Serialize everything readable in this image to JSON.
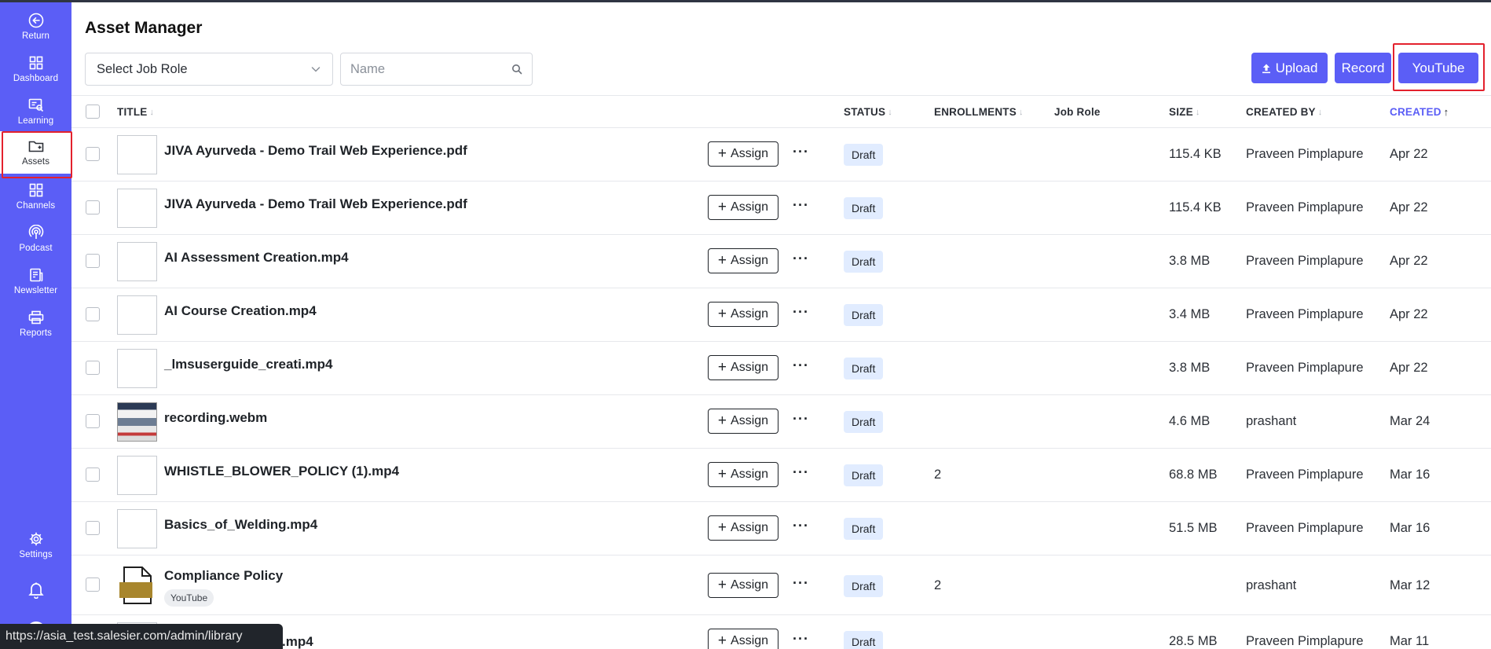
{
  "sidebar": {
    "items": [
      {
        "label": "Return",
        "icon": "return-icon"
      },
      {
        "label": "Dashboard",
        "icon": "dashboard-icon"
      },
      {
        "label": "Learning",
        "icon": "learning-icon"
      },
      {
        "label": "Assets",
        "icon": "assets-folder-icon",
        "active": true
      },
      {
        "label": "Channels",
        "icon": "channels-icon"
      },
      {
        "label": "Podcast",
        "icon": "podcast-icon"
      },
      {
        "label": "Newsletter",
        "icon": "newsletter-icon"
      },
      {
        "label": "Reports",
        "icon": "reports-printer-icon"
      }
    ],
    "bottom": [
      {
        "label": "Settings",
        "icon": "gear-icon"
      },
      {
        "label": "",
        "icon": "bell-icon"
      },
      {
        "label": "",
        "icon": "user-avatar-icon"
      }
    ]
  },
  "header": {
    "title": "Asset Manager",
    "job_role_select": "Select Job Role",
    "search_placeholder": "Name",
    "buttons": {
      "upload": "Upload",
      "record": "Record",
      "youtube": "YouTube"
    }
  },
  "table": {
    "columns": {
      "title": "TITLE",
      "status": "STATUS",
      "enrollments": "ENROLLMENTS",
      "job_role": "Job Role",
      "size": "SIZE",
      "created_by": "CREATED BY",
      "created": "CREATED"
    },
    "assign_label": "Assign",
    "more_label": "···",
    "rows": [
      {
        "title": "JIVA Ayurveda - Demo Trail Web Experience.pdf",
        "status": "Draft",
        "enrollments": "",
        "job_role": "",
        "size": "115.4 KB",
        "created_by": "Praveen Pimplapure",
        "created": "Apr 22",
        "thumb": "blank"
      },
      {
        "title": "JIVA Ayurveda - Demo Trail Web Experience.pdf",
        "status": "Draft",
        "enrollments": "",
        "job_role": "",
        "size": "115.4 KB",
        "created_by": "Praveen Pimplapure",
        "created": "Apr 22",
        "thumb": "blank"
      },
      {
        "title": "AI Assessment Creation.mp4",
        "status": "Draft",
        "enrollments": "",
        "job_role": "",
        "size": "3.8 MB",
        "created_by": "Praveen Pimplapure",
        "created": "Apr 22",
        "thumb": "blank"
      },
      {
        "title": "AI Course Creation.mp4",
        "status": "Draft",
        "enrollments": "",
        "job_role": "",
        "size": "3.4 MB",
        "created_by": "Praveen Pimplapure",
        "created": "Apr 22",
        "thumb": "blank"
      },
      {
        "title": "_lmsuserguide_creati.mp4",
        "status": "Draft",
        "enrollments": "",
        "job_role": "",
        "size": "3.8 MB",
        "created_by": "Praveen Pimplapure",
        "created": "Apr 22",
        "thumb": "blank"
      },
      {
        "title": "recording.webm",
        "status": "Draft",
        "enrollments": "",
        "job_role": "",
        "size": "4.6 MB",
        "created_by": "prashant",
        "created": "Mar 24",
        "thumb": "image"
      },
      {
        "title": "WHISTLE_BLOWER_POLICY (1).mp4",
        "status": "Draft",
        "enrollments": "2",
        "job_role": "",
        "size": "68.8 MB",
        "created_by": "Praveen Pimplapure",
        "created": "Mar 16",
        "thumb": "blank"
      },
      {
        "title": "Basics_of_Welding.mp4",
        "status": "Draft",
        "enrollments": "",
        "job_role": "",
        "size": "51.5 MB",
        "created_by": "Praveen Pimplapure",
        "created": "Mar 16",
        "thumb": "blank"
      },
      {
        "title": "Compliance Policy",
        "tag": "YouTube",
        "status": "Draft",
        "enrollments": "2",
        "job_role": "",
        "size": "",
        "created_by": "prashant",
        "created": "Mar 12",
        "thumb": "document"
      },
      {
        "title": ".mp4",
        "status": "Draft",
        "enrollments": "",
        "job_role": "",
        "size": "28.5 MB",
        "created_by": "Praveen Pimplapure",
        "created": "Mar 11",
        "thumb": "blank"
      }
    ]
  },
  "status_bar": {
    "url": "https://asia_test.salesier.com/admin/library"
  },
  "colors": {
    "accent": "#5b5ef6",
    "highlight": "#e3212d",
    "status_bg": "#e1ecff"
  }
}
